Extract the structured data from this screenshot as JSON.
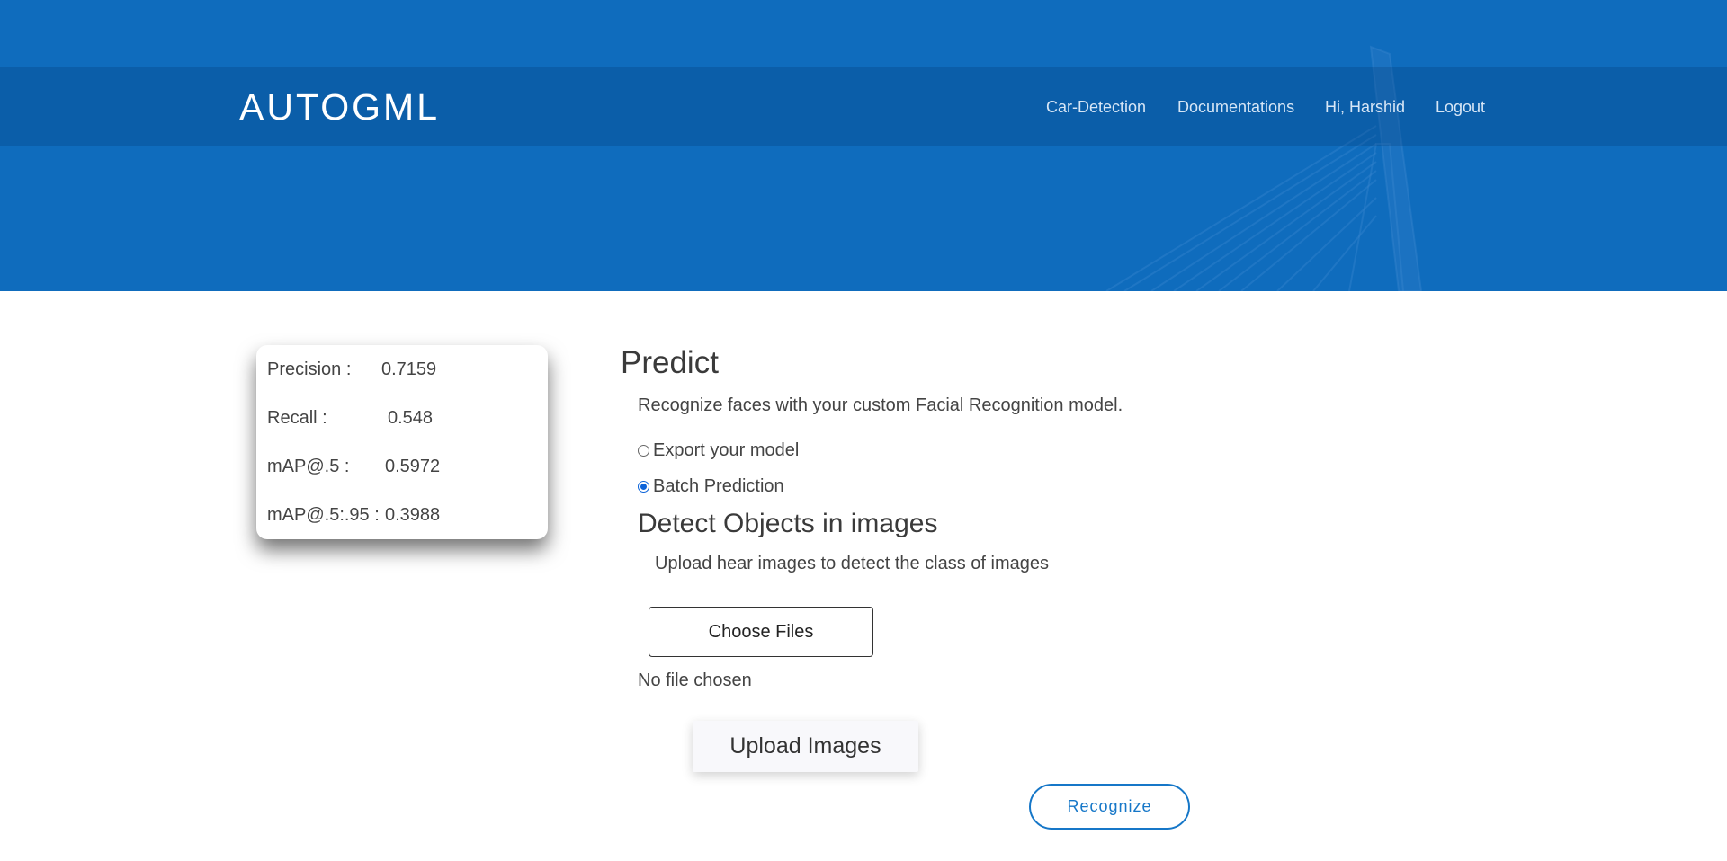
{
  "brand": "AUTOGML",
  "nav": {
    "car_detection": "Car-Detection",
    "documentations": "Documentations",
    "greeting": "Hi, Harshid",
    "logout": "Logout"
  },
  "metrics": [
    {
      "label": "Precision :",
      "value": "0.7159"
    },
    {
      "label": "Recall :",
      "value": "0.548"
    },
    {
      "label": "mAP@.5 :",
      "value": "0.5972"
    },
    {
      "label": "mAP@.5:.95 :",
      "value": "0.3988"
    }
  ],
  "predict": {
    "title": "Predict",
    "description": "Recognize faces with your custom Facial Recognition model.",
    "options": [
      {
        "label": "Export your model",
        "checked": false
      },
      {
        "label": "Batch Prediction",
        "checked": true
      }
    ],
    "detect_title": "Detect Objects in images",
    "detect_description": "Upload hear images to detect the class of images",
    "choose_files_label": "Choose Files",
    "no_file_text": "No file chosen",
    "upload_label": "Upload Images",
    "recognize_label": "Recognize"
  },
  "colors": {
    "hero_blue": "#0f6cbd",
    "accent_blue": "#1677c8",
    "radio_blue": "#0b63d9"
  }
}
